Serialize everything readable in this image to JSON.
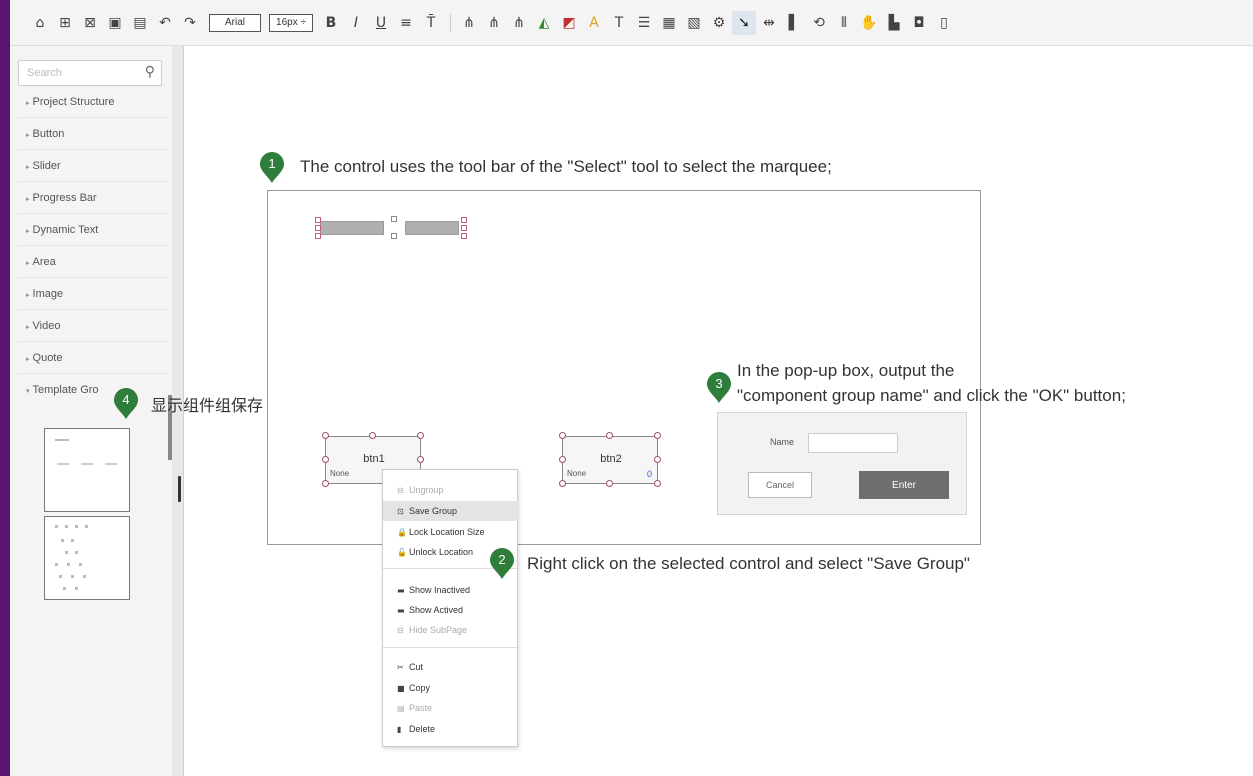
{
  "toolbar": {
    "font_name": "Arial",
    "font_size": "16px ÷",
    "icons": [
      "home-icon",
      "new-page-icon",
      "delete-page-icon",
      "copy-page-icon",
      "paste-page-icon",
      "undo-icon",
      "redo-icon"
    ]
  },
  "sidebar": {
    "search_placeholder": "Search",
    "items": [
      {
        "label": "Project Structure"
      },
      {
        "label": "Button"
      },
      {
        "label": "Slider"
      },
      {
        "label": "Progress Bar"
      },
      {
        "label": "Dynamic Text"
      },
      {
        "label": "Area"
      },
      {
        "label": "Image"
      },
      {
        "label": "Video"
      },
      {
        "label": "Quote"
      },
      {
        "label": "Template Gro"
      }
    ]
  },
  "annotations": {
    "step1_num": "1",
    "step1": "The control uses the tool bar of the \"Select\" tool to select the marquee;",
    "step2_num": "2",
    "step2": "Right click on the selected control and select \"Save Group\"",
    "step3_num": "3",
    "step3_line1": "In the pop-up box, output the",
    "step3_line2": "\"component group name\" and click the \"OK\" button;",
    "step4_num": "4",
    "step4": "显示组件组保存"
  },
  "canvas": {
    "btn1": {
      "label": "btn1",
      "sub": "None"
    },
    "btn2": {
      "label": "btn2",
      "sub": "None",
      "num": "0"
    }
  },
  "context_menu": {
    "items": [
      {
        "label": "Ungroup",
        "icon": "ungroup-icon",
        "glyph": "⊟",
        "disabled": true
      },
      {
        "label": "Save Group",
        "icon": "save-group-icon",
        "glyph": "⊡",
        "highlight": true
      },
      {
        "label": "Lock Location Size",
        "icon": "lock-icon",
        "glyph": "🔒"
      },
      {
        "label": "Unlock Location",
        "icon": "unlock-icon",
        "glyph": "🔓"
      },
      {
        "label": "Show Inactived",
        "icon": "show-inactived-icon",
        "glyph": "▬"
      },
      {
        "label": "Show Actived",
        "icon": "show-actived-icon",
        "glyph": "▬"
      },
      {
        "label": "Hide SubPage",
        "icon": "hide-subpage-icon",
        "glyph": "⊟",
        "disabled": true
      },
      {
        "label": "Cut",
        "icon": "cut-icon",
        "glyph": "✂"
      },
      {
        "label": "Copy",
        "icon": "copy-icon",
        "glyph": "■"
      },
      {
        "label": "Paste",
        "icon": "paste-icon",
        "glyph": "▤",
        "disabled": true
      },
      {
        "label": "Delete",
        "icon": "delete-icon",
        "glyph": "▮"
      }
    ]
  },
  "dialog": {
    "name_label": "Name",
    "cancel_label": "Cancel",
    "enter_label": "Enter"
  },
  "colors": {
    "pin_green": "#2e7d3a",
    "border_purple": "#5a1470"
  }
}
